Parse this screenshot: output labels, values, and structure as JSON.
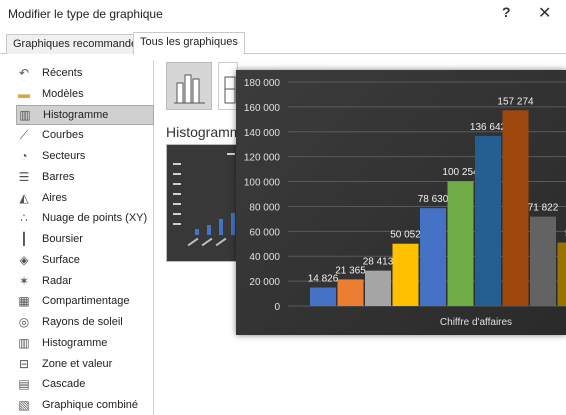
{
  "window": {
    "title": "Modifier le type de graphique",
    "help_label": "?",
    "close_label": "✕"
  },
  "tabs": [
    {
      "label": "Graphiques recommandés",
      "active": false
    },
    {
      "label": "Tous les graphiques",
      "active": true
    }
  ],
  "sidebar": {
    "items": [
      {
        "label": "Récents",
        "icon": "undo-icon"
      },
      {
        "label": "Modèles",
        "icon": "folder-icon"
      },
      {
        "label": "Histogramme",
        "icon": "column-chart-icon",
        "selected": true
      },
      {
        "label": "Courbes",
        "icon": "line-chart-icon"
      },
      {
        "label": "Secteurs",
        "icon": "pie-chart-icon"
      },
      {
        "label": "Barres",
        "icon": "bar-chart-icon"
      },
      {
        "label": "Aires",
        "icon": "area-chart-icon"
      },
      {
        "label": "Nuage de points (XY)",
        "icon": "scatter-chart-icon"
      },
      {
        "label": "Boursier",
        "icon": "stock-chart-icon"
      },
      {
        "label": "Surface",
        "icon": "surface-chart-icon"
      },
      {
        "label": "Radar",
        "icon": "radar-chart-icon"
      },
      {
        "label": "Compartimentage",
        "icon": "treemap-chart-icon"
      },
      {
        "label": "Rayons de soleil",
        "icon": "sunburst-chart-icon"
      },
      {
        "label": "Histogramme",
        "icon": "histogram-chart-icon"
      },
      {
        "label": "Zone et valeur",
        "icon": "box-whisker-chart-icon"
      },
      {
        "label": "Cascade",
        "icon": "waterfall-chart-icon"
      },
      {
        "label": "Graphique combiné",
        "icon": "combo-chart-icon"
      }
    ]
  },
  "main": {
    "section_title": "Histogramme"
  },
  "chart_data": {
    "type": "bar",
    "title": "",
    "xlabel": "Chiffre d'affaires",
    "ylabel": "",
    "ylim": [
      0,
      180000
    ],
    "y_ticks": [
      "0",
      "20 000",
      "40 000",
      "60 000",
      "80 000",
      "100 000",
      "120 000",
      "140 000",
      "160 000",
      "180 000"
    ],
    "grid": true,
    "series": [
      {
        "value": 14826,
        "label": "14 826",
        "color": "#4472c4"
      },
      {
        "value": 21365,
        "label": "21 365",
        "color": "#ed7d31"
      },
      {
        "value": 28413,
        "label": "28 413",
        "color": "#a5a5a5"
      },
      {
        "value": 50052,
        "label": "50 052",
        "color": "#ffc000"
      },
      {
        "value": 78630,
        "label": "78 630",
        "color": "#4472c4"
      },
      {
        "value": 100254,
        "label": "100 254",
        "color": "#70ad47"
      },
      {
        "value": 136642,
        "label": "136 642",
        "color": "#255e91"
      },
      {
        "value": 157274,
        "label": "157 274",
        "color": "#9e480e"
      },
      {
        "value": 71822,
        "label": "71 822",
        "color": "#636363"
      },
      {
        "value": 51000,
        "label": "51",
        "color": "#997300"
      }
    ]
  }
}
